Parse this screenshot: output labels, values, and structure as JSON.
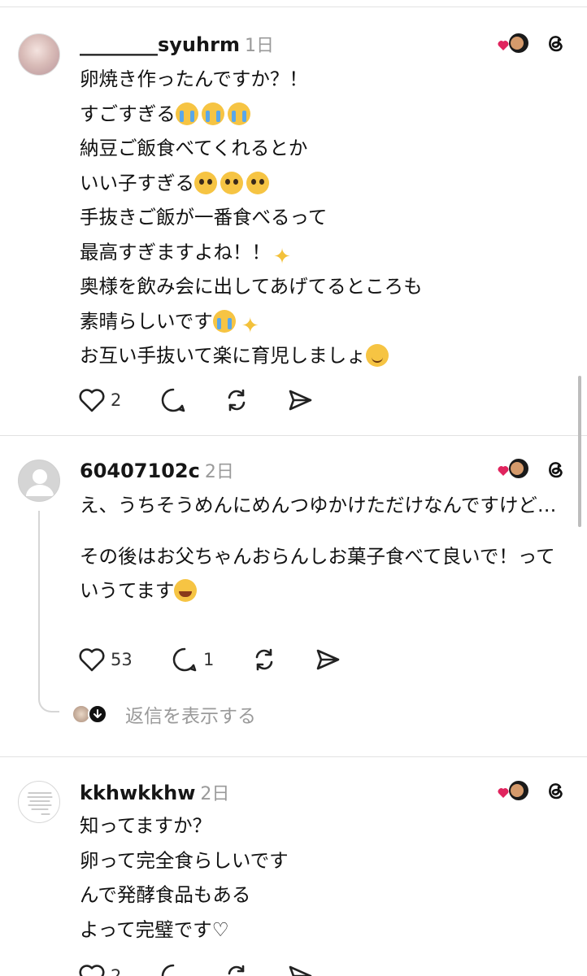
{
  "posts": [
    {
      "username": "________syuhrm",
      "time": "1日",
      "lines": [
        {
          "text": "卵焼き作ったんですか？！",
          "emojis": []
        },
        {
          "text": "すごすぎる",
          "emojis": [
            "crying",
            "crying",
            "crying"
          ]
        },
        {
          "text": "納豆ご飯食べてくれるとか",
          "emojis": []
        },
        {
          "text": "いい子すぎる",
          "emojis": [
            "pleading",
            "pleading",
            "pleading"
          ]
        },
        {
          "text": "手抜きご飯が一番食べるって",
          "emojis": []
        },
        {
          "text": "最高すぎますよね！！",
          "emojis": [
            "sparkles"
          ]
        },
        {
          "text": "奥様を飲み会に出してあげてるところも",
          "emojis": []
        },
        {
          "text": "素晴らしいです",
          "emojis": [
            "crying",
            "sparkles"
          ]
        },
        {
          "text": "お互い手抜いて楽に育児しましょ",
          "emojis": [
            "smiling"
          ]
        }
      ],
      "likes": "2",
      "comments": ""
    },
    {
      "username": "60407102c",
      "time": "2日",
      "para1": "え、うちそうめんにめんつゆかけただけなんですけど…",
      "para2": "その後はお父ちゃんおらんしお菓子食べて良いで！っていうてます",
      "para2_emoji": "tears-of-joy",
      "likes": "53",
      "comments": "1",
      "show_replies": "返信を表示する"
    },
    {
      "username": "kkhwkkhw",
      "time": "2日",
      "lines": [
        {
          "text": "知ってますか？"
        },
        {
          "text": "卵って完全食らしいです"
        },
        {
          "text": "んで発酵食品もある"
        },
        {
          "text": "よって完璧です♡"
        }
      ],
      "likes": "2"
    }
  ],
  "icons": {
    "like": "heart-icon",
    "comment": "comment-icon",
    "repost": "repost-icon",
    "share": "send-icon",
    "threads": "threads-logo-icon",
    "liked_by_author": "heart-badge-icon"
  },
  "colors": {
    "text": "#111111",
    "muted": "#9a9a9a",
    "heart_badge": "#e0245e",
    "divider": "#e2e2e2"
  }
}
